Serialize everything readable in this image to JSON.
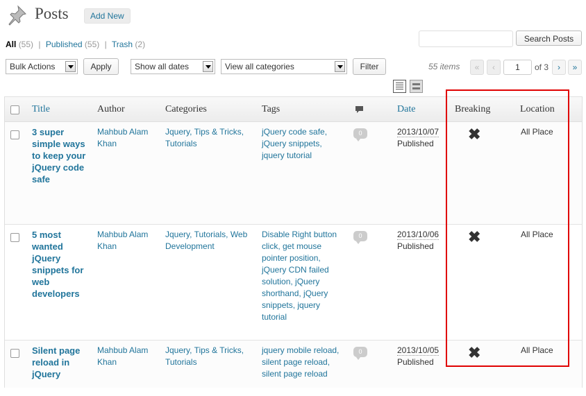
{
  "header": {
    "title": "Posts",
    "add_new": "Add New"
  },
  "views": {
    "all": "All",
    "all_count": "(55)",
    "published": "Published",
    "published_count": "(55)",
    "trash": "Trash",
    "trash_count": "(2)",
    "sep": "|"
  },
  "search": {
    "button": "Search Posts"
  },
  "filters": {
    "bulk_actions": "Bulk Actions",
    "apply": "Apply",
    "dates": "Show all dates",
    "categories": "View all categories",
    "filter": "Filter"
  },
  "pagination": {
    "items": "55 items",
    "first": "«",
    "prev": "‹",
    "current_page": "1",
    "of": "of 3",
    "next": "›",
    "last": "»"
  },
  "columns": {
    "title": "Title",
    "author": "Author",
    "categories": "Categories",
    "tags": "Tags",
    "date": "Date",
    "breaking": "Breaking",
    "location": "Location"
  },
  "rows": [
    {
      "title_lines": [
        "3 super",
        "simple ways",
        "to keep your",
        "jQuery code",
        "safe"
      ],
      "author_lines": [
        "Mahbub Alam",
        "Khan"
      ],
      "categories_lines": [
        "Jquery, Tips & Tricks,",
        "Tutorials"
      ],
      "tags_lines": [
        "jQuery code safe,",
        "jQuery snippets,",
        "jquery tutorial"
      ],
      "comments": "0",
      "date": "2013/10/07",
      "status": "Published",
      "breaking": "✖",
      "location": "All Place"
    },
    {
      "title_lines": [
        "5 most",
        "wanted",
        "jQuery",
        "snippets for",
        "web",
        "developers"
      ],
      "author_lines": [
        "Mahbub Alam",
        "Khan"
      ],
      "categories_lines": [
        "Jquery, Tutorials, Web",
        "Development"
      ],
      "tags_lines": [
        "Disable Right button",
        "click, get mouse",
        "pointer position,",
        "jQuery CDN failed",
        "solution, jQuery",
        "shorthand, jQuery",
        "snippets, jquery",
        "tutorial"
      ],
      "comments": "0",
      "date": "2013/10/06",
      "status": "Published",
      "breaking": "✖",
      "location": "All Place"
    },
    {
      "title_lines": [
        "Silent page",
        "reload in",
        "jQuery"
      ],
      "author_lines": [
        "Mahbub Alam",
        "Khan"
      ],
      "categories_lines": [
        "Jquery, Tips & Tricks,",
        "Tutorials"
      ],
      "tags_lines": [
        "jquery mobile reload,",
        "silent page reload,",
        "silent page reload"
      ],
      "comments": "0",
      "date": "2013/10/05",
      "status": "Published",
      "breaking": "✖",
      "location": "All Place"
    }
  ],
  "colors": {
    "link": "#21759b",
    "highlight": "#e00000"
  },
  "icons": {
    "pin": "pushpin-icon",
    "comments": "comment-bubble-icon",
    "list_view": "list-view-icon",
    "excerpt_view": "excerpt-view-icon"
  }
}
